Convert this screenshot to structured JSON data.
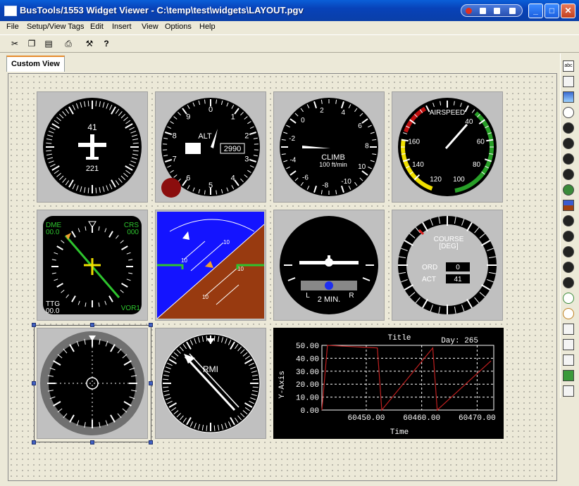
{
  "window": {
    "title": "BusTools/1553 Widget Viewer - C:\\temp\\test\\widgets\\LAYOUT.pgv"
  },
  "menu": [
    {
      "id": "file",
      "label": "File"
    },
    {
      "id": "setup",
      "label": "Setup/View Tags"
    },
    {
      "id": "edit",
      "label": "Edit"
    },
    {
      "id": "insert",
      "label": "Insert"
    },
    {
      "id": "view",
      "label": "View"
    },
    {
      "id": "options",
      "label": "Options"
    },
    {
      "id": "help",
      "label": "Help"
    }
  ],
  "toolbar": {
    "cut_icon": "scissors-icon",
    "copy_icon": "copy-icon",
    "paste_icon": "paste-icon",
    "print_icon": "printer-icon",
    "tools_icon": "tools-icon",
    "help_icon": "help-icon"
  },
  "tab": {
    "label": "Custom View"
  },
  "palette": {
    "text_tool": "abc"
  },
  "heading": {
    "top": "41",
    "bottom": "221"
  },
  "altimeter": {
    "label": "ALT",
    "value": "2990",
    "ticks": [
      "0",
      "1",
      "2",
      "3",
      "4",
      "5",
      "6",
      "7",
      "8",
      "9"
    ]
  },
  "climb": {
    "label": "CLIMB",
    "units": "100 ft/min",
    "ticks": [
      "4",
      "6",
      "8",
      "10",
      "-10",
      "-8",
      "-6",
      "-4",
      "-2",
      "0",
      "2"
    ]
  },
  "airspeed": {
    "label": "AIRSPEED",
    "ticks": [
      "40",
      "60",
      "80",
      "100",
      "120",
      "140",
      "160"
    ]
  },
  "hsi": {
    "dme": "DME",
    "dme_value": "00.0",
    "crs": "CRS",
    "crs_value": "000",
    "ttg": "TTG",
    "ttg_value": "00.0",
    "vor": "VOR1"
  },
  "adi": {
    "ladder": [
      "10",
      "10",
      "10",
      "10"
    ]
  },
  "turn": {
    "left": "L",
    "right": "R",
    "label": "2 MIN."
  },
  "course": {
    "title": "COURSE",
    "units": "[DEG]",
    "ord_label": "ORD",
    "ord_value": "0",
    "act_label": "ACT",
    "act_value": "41"
  },
  "rmi": {
    "label": "RMI"
  },
  "chart_data": {
    "type": "line",
    "title": "Title",
    "annotation": "Day: 265",
    "xlabel": "Time",
    "ylabel": "Y-Axis",
    "xlim": [
      60442,
      60473
    ],
    "ylim": [
      0,
      50
    ],
    "xticks": [
      "60450.00",
      "60460.00",
      "60470.00"
    ],
    "yticks": [
      "0.00",
      "10.00",
      "20.00",
      "30.00",
      "40.00",
      "50.00"
    ],
    "grid": true,
    "colors": {
      "background": "#000000",
      "line": "#c02020",
      "grid": "#ffffff",
      "text": "#ffffff"
    },
    "series": [
      {
        "x": [
          60442,
          60443,
          60452,
          60452.8,
          60462,
          60462.8,
          60472.5
        ],
        "y": [
          0,
          50,
          48,
          0,
          48,
          0,
          38
        ]
      }
    ]
  }
}
